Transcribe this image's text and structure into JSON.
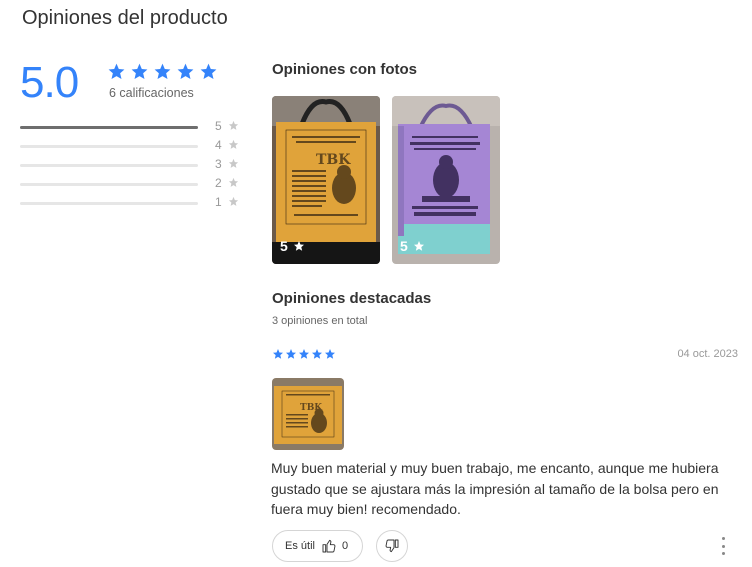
{
  "page": {
    "title": "Opiniones del producto"
  },
  "summary": {
    "score": "5.0",
    "stars": 5,
    "ratings_label": "6 calificaciones",
    "distribution": [
      {
        "label": "5",
        "fraction": 1.0
      },
      {
        "label": "4",
        "fraction": 0.0
      },
      {
        "label": "3",
        "fraction": 0.0
      },
      {
        "label": "2",
        "fraction": 0.0
      },
      {
        "label": "1",
        "fraction": 0.0
      }
    ]
  },
  "photos": {
    "title": "Opiniones con fotos",
    "items": [
      {
        "rating": "5",
        "color": "#e0a33a"
      },
      {
        "rating": "5",
        "color": "#a586d4"
      }
    ]
  },
  "featured": {
    "title": "Opiniones destacadas",
    "total_label": "3 opiniones en total"
  },
  "review": {
    "stars": 5,
    "date": "04 oct. 2023",
    "text": "Muy buen material y muy buen trabajo, me encanto, aunque me hubiera gustado que se ajustara más la impresión al tamaño de la bolsa pero en fuera muy bien! recomendado.",
    "useful_label": "Es útil",
    "useful_count": "0"
  },
  "colors": {
    "accent": "#3483fa",
    "bar_fill": "#6e6e6e",
    "bar_track": "#e6e6e6"
  }
}
